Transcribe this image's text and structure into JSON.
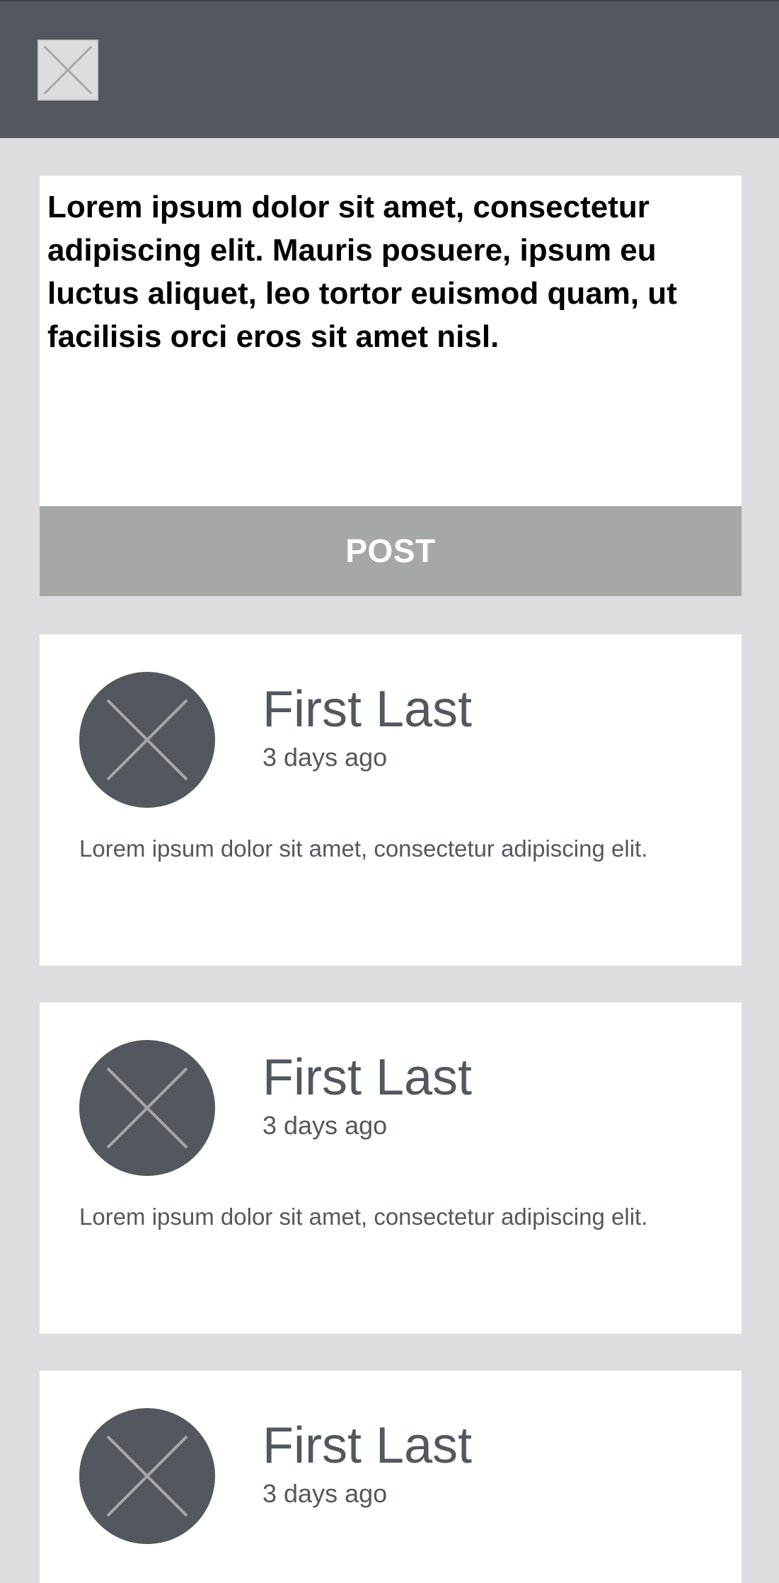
{
  "composer": {
    "text": "Lorem ipsum dolor sit amet, consectetur adipiscing elit. Mauris posuere, ipsum eu luctus aliquet, leo tortor euismod quam, ut facilisis orci eros sit amet nisl.",
    "post_label": "POST"
  },
  "feed": {
    "items": [
      {
        "name": "First Last",
        "time": "3 days ago",
        "text": "Lorem ipsum dolor sit amet, consectetur adipiscing elit."
      },
      {
        "name": "First Last",
        "time": "3 days ago",
        "text": "Lorem ipsum dolor sit amet, consectetur adipiscing elit."
      },
      {
        "name": "First Last",
        "time": "3 days ago",
        "text": ""
      }
    ]
  },
  "colors": {
    "header": "#53585f",
    "background": "#dcdde0",
    "button": "#a4a8a7",
    "text": "#53585f"
  },
  "icons": {
    "header_logo": "placeholder-image-icon",
    "avatar": "placeholder-avatar-icon"
  }
}
